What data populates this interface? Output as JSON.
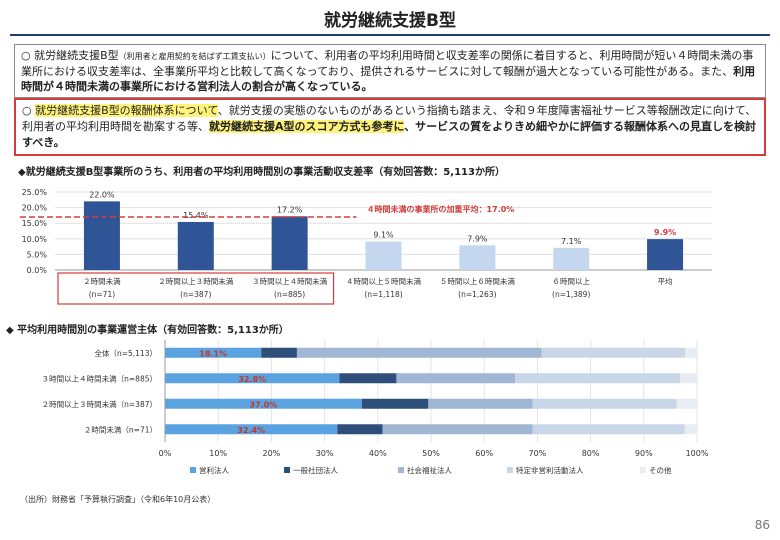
{
  "title": "就労継続支援B型",
  "box1": {
    "bullet": "○",
    "text_a": "就労継続支援B型",
    "text_small": "（利用者と雇用契約を結ばず工賃支払い）",
    "text_b": "について、利用者の平均利用時間と収支差率の関係に着目すると、利用時間が短い４時間未満の事業所における収支差率は、全事業所平均と比較して高くなっており、提供されるサービスに対して報酬が過大となっている可能性がある。また、",
    "text_bold": "利用時間が４時間未満の事業所における営利法人の割合が高くなっている。"
  },
  "box2": {
    "bullet": "○",
    "hl1": "就労継続支援B型の報酬体系について",
    "text_a": "、就労支援の実態のないものがあるという指摘も踏まえ、令和９年度障害福祉サービス等報酬改定に向けて、利用者の平均利用時間を勘案する等、",
    "hl2": "就労継続支援A型のスコア方式も参考に",
    "text_b": "、サービスの質をよりきめ細やかに評価する報酬体系への見直しを検討すべき。"
  },
  "chart1_title": "◆就労継続支援B型事業所のうち、利用者の平均利用時間別の事業活動収支差率（有効回答数：5,113か所）",
  "chart2_title": "◆ 平均利用時間別の事業運営主体（有効回答数：5,113か所）",
  "source": "（出所）財務省「予算執行調査」（令和6年10月公表）",
  "page_number": "86",
  "chart_data": [
    {
      "type": "bar",
      "title": "就労継続支援B型事業所のうち、利用者の平均利用時間別の事業活動収支差率（有効回答数：5,113か所）",
      "categories": [
        "２時間未満",
        "２時間以上３時間未満",
        "３時間以上４時間未満",
        "４時間以上５時間未満",
        "５時間以上６時間未満",
        "６時間以上",
        "平均"
      ],
      "counts": [
        "(n=71)",
        "(n=387)",
        "(n=885)",
        "(n=1,118)",
        "(n=1,263)",
        "(n=1,389)",
        ""
      ],
      "values": [
        22.0,
        15.4,
        17.2,
        9.1,
        7.9,
        7.1,
        9.9
      ],
      "value_labels": [
        "22.0%",
        "15.4%",
        "17.2%",
        "9.1%",
        "7.9%",
        "7.1%",
        "9.9%"
      ],
      "yticks": [
        "0.0%",
        "5.0%",
        "10.0%",
        "15.0%",
        "20.0%",
        "25.0%"
      ],
      "ylim": [
        0,
        25
      ],
      "reference_line": {
        "value": 17.0,
        "label": "４時間未満の事業所の加重平均：17.0%",
        "color": "#d63b3b"
      },
      "colors": {
        "dark": "#2f5597",
        "light": "#c5d7ee",
        "avg_label": "#d63b3b"
      },
      "grid": true
    },
    {
      "type": "bar",
      "stacked": true,
      "orientation": "horizontal",
      "title": "平均利用時間別の事業運営主体（有効回答数：5,113か所）",
      "categories": [
        "全体（n=5,113）",
        "３時間以上４時間未満（n=885）",
        "２時間以上３時間未満（n=387）",
        "２時間未満（n=71）"
      ],
      "series": [
        {
          "name": "営利法人",
          "values": [
            18.1,
            32.8,
            37.0,
            32.4
          ],
          "labels": [
            "18.1%",
            "32.8%",
            "37.0%",
            "32.4%"
          ],
          "color": "#5ba3e0"
        },
        {
          "name": "一般社団法人",
          "values": [
            6.7,
            10.7,
            12.5,
            8.5
          ],
          "color": "#2e4f7a"
        },
        {
          "name": "社会福祉法人",
          "values": [
            46.0,
            22.3,
            19.6,
            28.2
          ],
          "color": "#9fb7d5"
        },
        {
          "name": "特定非営利活動法人",
          "values": [
            27.0,
            31.0,
            27.1,
            28.6
          ],
          "color": "#c9d6e8"
        },
        {
          "name": "その他",
          "values": [
            2.2,
            3.2,
            3.8,
            2.3
          ],
          "color": "#e8edf4"
        }
      ],
      "xticks": [
        "0%",
        "10%",
        "20%",
        "30%",
        "40%",
        "50%",
        "60%",
        "70%",
        "80%",
        "90%",
        "100%"
      ],
      "xlim": [
        0,
        100
      ],
      "label_color": "#c0392b",
      "legend_position": "bottom"
    }
  ]
}
